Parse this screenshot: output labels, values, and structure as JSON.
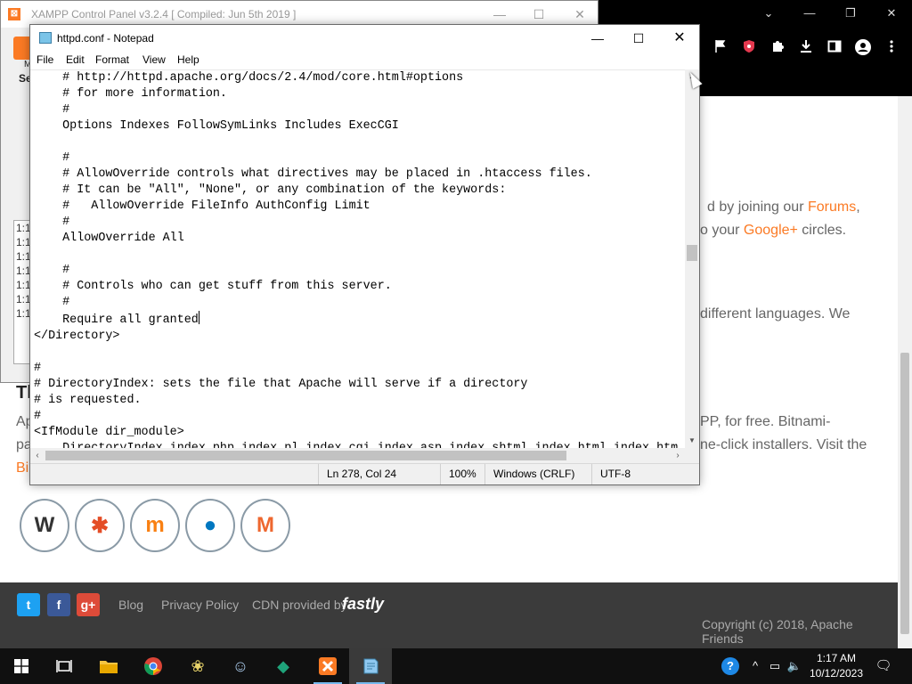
{
  "browser": {
    "titlebar_buttons": [
      "⌄",
      "—",
      "❐",
      "✕"
    ],
    "toolbar_icons": [
      "flag-icon",
      "shield-icon",
      "puzzle-icon",
      "download-icon",
      "sidebar-icon",
      "profile-icon",
      "more-icon"
    ],
    "page": {
      "text_lines": [
        {
          "before": "d by joining our ",
          "link": "Forums",
          "after": ","
        },
        {
          "before": "o your ",
          "link": "Google+",
          "after": " circles."
        },
        {
          "before": "different languages. We",
          "link": "",
          "after": ""
        },
        {
          "before": "PP, for free. Bitnami-",
          "link": "",
          "after": ""
        },
        {
          "before": "ne-click installers. Visit the",
          "link": "",
          "after": ""
        }
      ],
      "left_fragments": [
        "Tl",
        "Ap",
        "pa",
        "Bi"
      ],
      "app_icons": [
        {
          "name": "wordpress",
          "glyph": "W",
          "color": "#333333"
        },
        {
          "name": "joomla",
          "glyph": "✱",
          "color": "#e44d26"
        },
        {
          "name": "moodle",
          "glyph": "m",
          "color": "#f98012"
        },
        {
          "name": "drupal",
          "glyph": "💧",
          "color": "#0077c0"
        },
        {
          "name": "magento",
          "glyph": "M",
          "color": "#ee672f"
        }
      ],
      "footer": {
        "social": [
          {
            "name": "twitter",
            "glyph": "t",
            "color": "#1da1f2"
          },
          {
            "name": "facebook",
            "glyph": "f",
            "color": "#3b5998"
          },
          {
            "name": "google-plus",
            "glyph": "g+",
            "color": "#dd4b39"
          }
        ],
        "links": [
          "Blog",
          "Privacy Policy",
          "CDN provided by"
        ],
        "cdn_brand": "fastly",
        "copyright": "Copyright (c) 2018, Apache Friends"
      }
    }
  },
  "xampp": {
    "title": "XAMPP Control Panel v3.2.4   [ Compiled: Jun 5th 2019 ]",
    "controls": [
      "—",
      "☐",
      "✕"
    ],
    "side_label_1": "M",
    "side_label_2": "Se",
    "log_lines": [
      "1:1",
      "1:1",
      "1:1",
      "1:1",
      "1:1",
      "1:1",
      "1:1"
    ]
  },
  "notepad": {
    "title": "httpd.conf - Notepad",
    "controls": [
      "—",
      "☐",
      "✕"
    ],
    "menu": [
      "File",
      "Edit",
      "Format",
      "View",
      "Help"
    ],
    "lines_before_caret": [
      "    # http://httpd.apache.org/docs/2.4/mod/core.html#options",
      "    # for more information.",
      "    #",
      "    Options Indexes FollowSymLinks Includes ExecCGI",
      "",
      "    #",
      "    # AllowOverride controls what directives may be placed in .htaccess files.",
      "    # It can be \"All\", \"None\", or any combination of the keywords:",
      "    #   AllowOverride FileInfo AuthConfig Limit",
      "    #",
      "    AllowOverride All",
      "",
      "    #",
      "    # Controls who can get stuff from this server.",
      "    #",
      "    Require all granted"
    ],
    "lines_after_caret": [
      "</Directory>",
      "",
      "#",
      "# DirectoryIndex: sets the file that Apache will serve if a directory",
      "# is requested.",
      "#",
      "<IfModule dir_module>",
      "    DirectoryIndex index.php index.pl index.cgi index.asp index.shtml index.html index.htm"
    ],
    "status": {
      "position": "Ln 278, Col 24",
      "zoom": "100%",
      "line_ending": "Windows (CRLF)",
      "encoding": "UTF-8"
    }
  },
  "taskbar": {
    "apps": [
      {
        "name": "start",
        "glyph": "⊞",
        "color": "#ffffff"
      },
      {
        "name": "task-view",
        "glyph": "▭",
        "color": "#ffffff"
      },
      {
        "name": "file-explorer",
        "glyph": "▬",
        "color": "#f4c542"
      },
      {
        "name": "chrome",
        "glyph": "◉",
        "color": "#4caf50"
      },
      {
        "name": "app-bee",
        "glyph": "❀",
        "color": "#e8d36a"
      },
      {
        "name": "app-anime",
        "glyph": "☺",
        "color": "#a8c8e8"
      },
      {
        "name": "app-green",
        "glyph": "◆",
        "color": "#1fa37a"
      },
      {
        "name": "xampp",
        "glyph": "☒",
        "color": "#fb7a24"
      },
      {
        "name": "notepad",
        "glyph": "✎",
        "color": "#8fc8f0"
      }
    ],
    "tray": [
      "?",
      "^",
      "▭",
      "🔈"
    ],
    "time": "1:17 AM",
    "date": "10/12/2023",
    "notification_glyph": "🗨"
  }
}
